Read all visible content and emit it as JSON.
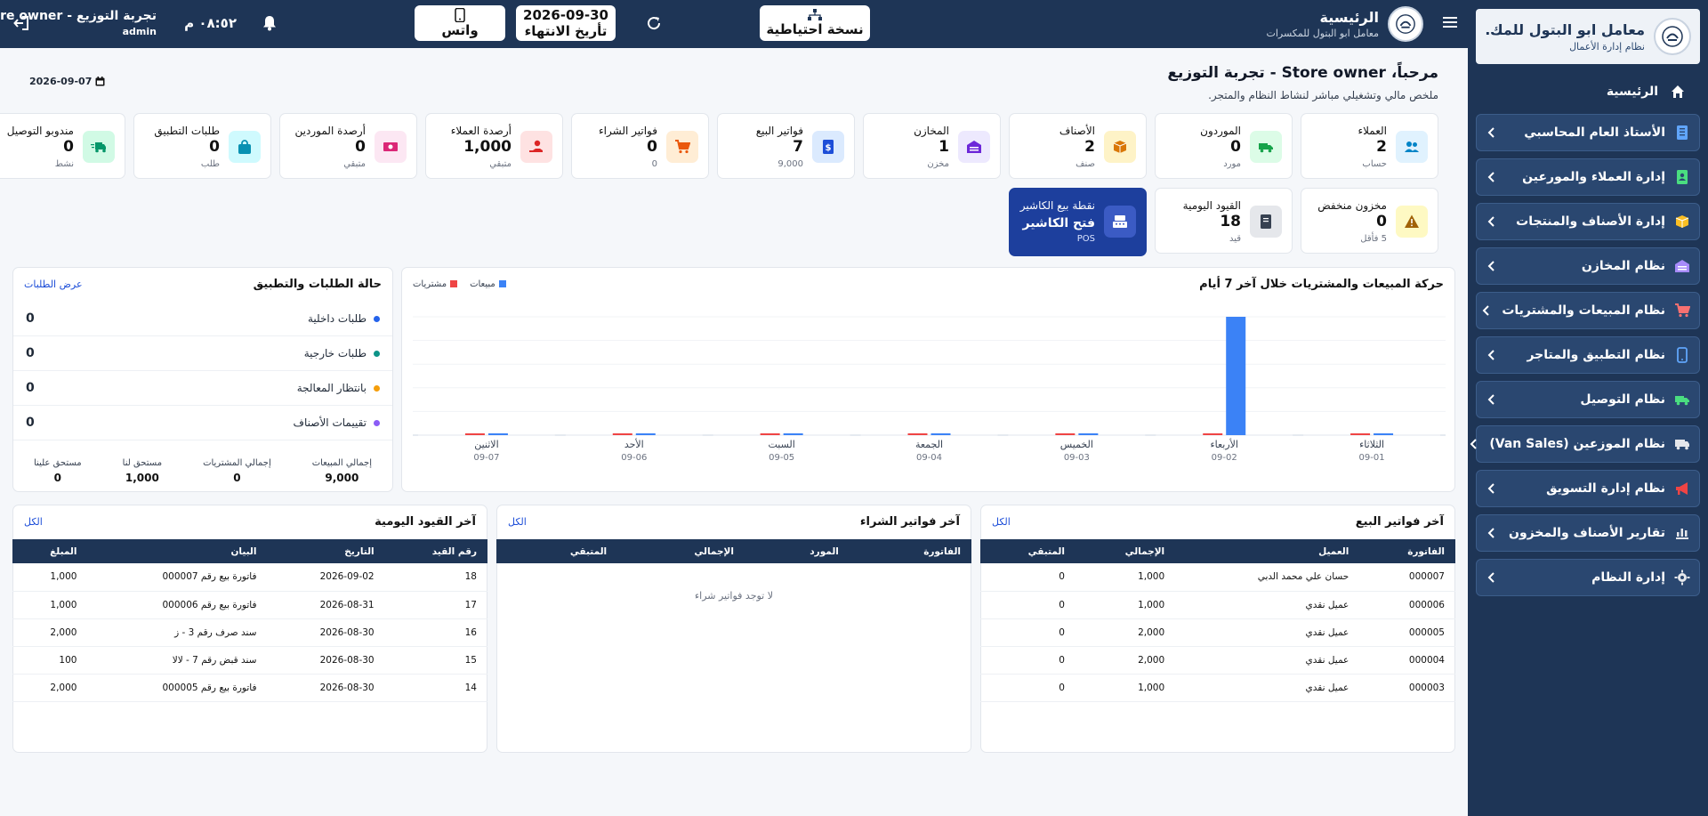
{
  "sidebar": {
    "brand_title": "معامل ابو البتول للمك...",
    "brand_subtitle": "نظام إدارة الأعمال",
    "home_label": "الرئيسية",
    "items": [
      {
        "label": "الأستاذ العام المحاسبي",
        "icon": "ledger-icon"
      },
      {
        "label": "إدارة العملاء والمورعين",
        "icon": "contacts-icon"
      },
      {
        "label": "إدارة الأصناف والمنتجات",
        "icon": "box-icon"
      },
      {
        "label": "نظام المخازن",
        "icon": "warehouse-icon"
      },
      {
        "label": "نظام المبيعات والمشتريات",
        "icon": "cart-icon"
      },
      {
        "label": "نظام التطبيق والمتاجر",
        "icon": "mobile-icon"
      },
      {
        "label": "نظام التوصيل",
        "icon": "truck-icon"
      },
      {
        "label": "نظام الموزعين (Van Sales)",
        "icon": "van-icon"
      },
      {
        "label": "نظام إدارة التسويق",
        "icon": "megaphone-icon"
      },
      {
        "label": "تقارير الأصناف والمخزون",
        "icon": "report-icon"
      },
      {
        "label": "إدارة النظام",
        "icon": "gear-icon"
      }
    ]
  },
  "topbar": {
    "home_title": "الرئيسية",
    "home_subtitle": "معامل ابو البتول للمكسرات",
    "backup_label": "نسخة احتياطية",
    "expiry_date": "2026-09-30",
    "expiry_label": "تأريخ الانتهاء",
    "whatsapp_label": "واتس",
    "clock": "٠٨:٥٢ م",
    "user_name": "تجربة التوزيع - Store owner",
    "user_role": "admin"
  },
  "welcome": {
    "title": "مرحباً، Store owner - تجربة التوزيع",
    "subtitle": "ملخص مالي وتشغيلي مباشر لنشاط النظام والمتجر.",
    "date": "2026-09-07"
  },
  "stats_row1": [
    {
      "label": "العملاء",
      "value": "2",
      "sub": "حساب",
      "icon": "users-icon",
      "bg": "#e0f2fe",
      "fg": "#0284c7"
    },
    {
      "label": "الموردون",
      "value": "0",
      "sub": "مورد",
      "icon": "truck-icon",
      "bg": "#dcfce7",
      "fg": "#16a34a"
    },
    {
      "label": "الأصناف",
      "value": "2",
      "sub": "صنف",
      "icon": "box-icon",
      "bg": "#fef3c7",
      "fg": "#d97706"
    },
    {
      "label": "المخازن",
      "value": "1",
      "sub": "مخزن",
      "icon": "warehouse-icon",
      "bg": "#ede9fe",
      "fg": "#6d28d9"
    },
    {
      "label": "فواتير البيع",
      "value": "7",
      "sub": "9,000",
      "icon": "invoice-icon",
      "bg": "#dbeafe",
      "fg": "#1d4ed8"
    },
    {
      "label": "فواتير الشراء",
      "value": "0",
      "sub": "0",
      "icon": "cart-icon",
      "bg": "#ffedd5",
      "fg": "#ea580c"
    },
    {
      "label": "أرصدة العملاء",
      "value": "1,000",
      "sub": "متبقي",
      "icon": "hand-coin-icon",
      "bg": "#fee2e2",
      "fg": "#dc2626"
    },
    {
      "label": "أرصدة الموردين",
      "value": "0",
      "sub": "متبقي",
      "icon": "money-icon",
      "bg": "#fce7f3",
      "fg": "#db2777"
    },
    {
      "label": "طلبات التطبيق",
      "value": "0",
      "sub": "طلب",
      "icon": "bag-icon",
      "bg": "#cffafe",
      "fg": "#0891b2"
    },
    {
      "label": "مندوبو التوصيل",
      "value": "0",
      "sub": "نشط",
      "icon": "delivery-icon",
      "bg": "#d1fae5",
      "fg": "#059669"
    }
  ],
  "stats_row2": [
    {
      "label": "مخزون منخفض",
      "value": "0",
      "sub": "5 فأقل",
      "icon": "warning-icon",
      "bg": "#fef9c3",
      "fg": "#a16207"
    },
    {
      "label": "القيود اليومية",
      "value": "18",
      "sub": "قيد",
      "icon": "journal-icon",
      "bg": "#e5e7eb",
      "fg": "#374151"
    },
    {
      "label": "نقطة بيع الكاشير",
      "value": "فتح الكاشير",
      "sub": "POS",
      "icon": "cash-register-icon",
      "bg": "#3b5bc4",
      "fg": "#ffffff"
    }
  ],
  "chart_panel": {
    "title": "حركة المبيعات والمشتريات خلال آخر 7 أيام",
    "legend_sales": "مبيعات",
    "legend_purchases": "مشتريات",
    "sales_color": "#3b82f6",
    "purchases_color": "#ef4444"
  },
  "chart_data": {
    "type": "bar",
    "categories": [
      "الثلاثاء",
      "الأربعاء",
      "الخميس",
      "الجمعة",
      "السبت",
      "الأحد",
      "الاثنين"
    ],
    "dates": [
      "09-01",
      "09-02",
      "09-03",
      "09-04",
      "09-05",
      "09-06",
      "09-07"
    ],
    "series": [
      {
        "name": "مبيعات",
        "values": [
          0,
          9000,
          0,
          0,
          0,
          0,
          0
        ]
      },
      {
        "name": "مشتريات",
        "values": [
          0,
          0,
          0,
          0,
          0,
          0,
          0
        ]
      }
    ],
    "ylim": [
      0,
      9000
    ],
    "grid": true,
    "legend": "top-left"
  },
  "status_panel": {
    "title": "حالة الطلبات والتطبيق",
    "link": "عرض الطلبات",
    "rows": [
      {
        "label": "طلبات داخلية",
        "value": "0",
        "color": "#2563eb"
      },
      {
        "label": "طلبات خارجية",
        "value": "0",
        "color": "#0d9488"
      },
      {
        "label": "بانتظار المعالجة",
        "value": "0",
        "color": "#f59e0b"
      },
      {
        "label": "تقييمات الأصناف",
        "value": "0",
        "color": "#8b5cf6"
      }
    ],
    "totals": [
      {
        "label": "إجمالي المبيعات",
        "value": "9,000"
      },
      {
        "label": "إجمالي المشتريات",
        "value": "0"
      },
      {
        "label": "مستحق لنا",
        "value": "1,000"
      },
      {
        "label": "مستحق علينا",
        "value": "0"
      }
    ]
  },
  "sales_table": {
    "title": "آخر فواتير البيع",
    "link": "الكل",
    "headers": [
      "الفاتورة",
      "العميل",
      "الإجمالي",
      "المتبقي"
    ],
    "rows": [
      [
        "000007",
        "حسان علي محمد الدبي",
        "1,000",
        "0"
      ],
      [
        "000006",
        "عميل نقدي",
        "1,000",
        "0"
      ],
      [
        "000005",
        "عميل نقدي",
        "2,000",
        "0"
      ],
      [
        "000004",
        "عميل نقدي",
        "2,000",
        "0"
      ],
      [
        "000003",
        "عميل نقدي",
        "1,000",
        "0"
      ]
    ]
  },
  "purchase_table": {
    "title": "آخر فواتير الشراء",
    "link": "الكل",
    "headers": [
      "الفاتورة",
      "المورد",
      "الإجمالي",
      "المتبقي"
    ],
    "empty": "لا توجد فواتير شراء"
  },
  "journal_table": {
    "title": "آخر القيود اليومية",
    "link": "الكل",
    "headers": [
      "رقم القيد",
      "التاريخ",
      "البيان",
      "المبلغ"
    ],
    "rows": [
      [
        "18",
        "2026-09-02",
        "فاتورة بيع رقم 000007",
        "1,000"
      ],
      [
        "17",
        "2026-08-31",
        "فاتورة بيع رقم 000006",
        "1,000"
      ],
      [
        "16",
        "2026-08-30",
        "سند صرف رقم 3 - ز",
        "2,000"
      ],
      [
        "15",
        "2026-08-30",
        "سند قبض رقم 7 - لالا",
        "100"
      ],
      [
        "14",
        "2026-08-30",
        "فاتورة بيع رقم 000005",
        "2,000"
      ]
    ]
  }
}
